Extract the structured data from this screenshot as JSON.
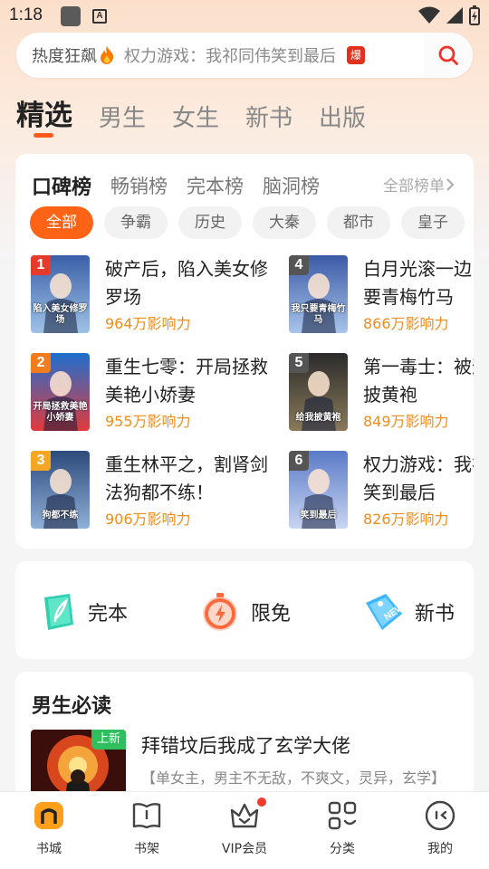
{
  "status_bar": {
    "time": "1:18",
    "icon_b": "A"
  },
  "search": {
    "hot_label": "热度狂飙",
    "query": "权力游戏：我祁同伟笑到最后",
    "badge": "爆"
  },
  "category_tabs": [
    {
      "label": "精选",
      "active": true
    },
    {
      "label": "男生"
    },
    {
      "label": "女生"
    },
    {
      "label": "新书"
    },
    {
      "label": "出版"
    }
  ],
  "ranking": {
    "tabs": [
      "口碑榜",
      "畅销榜",
      "完本榜",
      "脑洞榜"
    ],
    "all_label": "全部榜单",
    "chips": [
      "全部",
      "争霸",
      "历史",
      "大秦",
      "都市",
      "皇子"
    ],
    "books": [
      {
        "rank": "1",
        "title": "破产后，陷入美女修罗场",
        "influence": "964万影响力",
        "rank_color": "#e63a2a",
        "cover_top": "#3a5fa8",
        "cover_bottom": "#9fc3e6",
        "cover_text": "陷入美女修罗场"
      },
      {
        "rank": "2",
        "title": "重生七零：开局拯救美艳小娇妻",
        "influence": "955万影响力",
        "rank_color": "#f07c1e",
        "cover_top": "#1e6fd0",
        "cover_bottom": "#e23a3a",
        "cover_text": "开局拯救美艳小娇妻"
      },
      {
        "rank": "3",
        "title": "重生林平之，割肾剑法狗都不练！",
        "influence": "906万影响力",
        "rank_color": "#f5a623",
        "cover_top": "#2c4a7a",
        "cover_bottom": "#8fb0d8",
        "cover_text": "狗都不练"
      },
      {
        "rank": "4",
        "title": "白月光滚一边，我只要青梅竹马",
        "influence": "866万影响力",
        "rank_color": "#555555",
        "cover_top": "#3b5aa6",
        "cover_bottom": "#a8c4ea",
        "cover_text": "我只要青梅竹马"
      },
      {
        "rank": "5",
        "title": "第一毒士：被逼给我披黄袍",
        "influence": "849万影响力",
        "rank_color": "#555555",
        "cover_top": "#2b2b2b",
        "cover_bottom": "#8a7a5a",
        "cover_text": "给我披黄袍"
      },
      {
        "rank": "6",
        "title": "权力游戏：我祁同伟笑到最后",
        "influence": "826万影响力",
        "rank_color": "#555555",
        "cover_top": "#5a7ac8",
        "cover_bottom": "#c9d6f2",
        "cover_text": "笑到最后"
      }
    ]
  },
  "quick_entries": [
    {
      "label": "完本",
      "icon": "book-feather-icon"
    },
    {
      "label": "限免",
      "icon": "limited-free-clock-icon"
    },
    {
      "label": "新书",
      "icon": "new-tag-icon"
    }
  ],
  "must_read": {
    "title": "男生必读",
    "book_title": "拜错坟后我成了玄学大佬",
    "badge": "上新",
    "description": "【单女主，男主不无敌，不爽文，灵异，玄学】"
  },
  "bottom_nav": [
    {
      "label": "书城",
      "icon": "bookstore-icon",
      "active": true
    },
    {
      "label": "书架",
      "icon": "bookshelf-icon"
    },
    {
      "label": "VIP会员",
      "icon": "vip-crown-icon"
    },
    {
      "label": "分类",
      "icon": "category-icon"
    },
    {
      "label": "我的",
      "icon": "profile-icon"
    }
  ],
  "colors": {
    "accent": "#ff6416",
    "influence": "#f08c1c",
    "badge_red": "#e0301e"
  }
}
